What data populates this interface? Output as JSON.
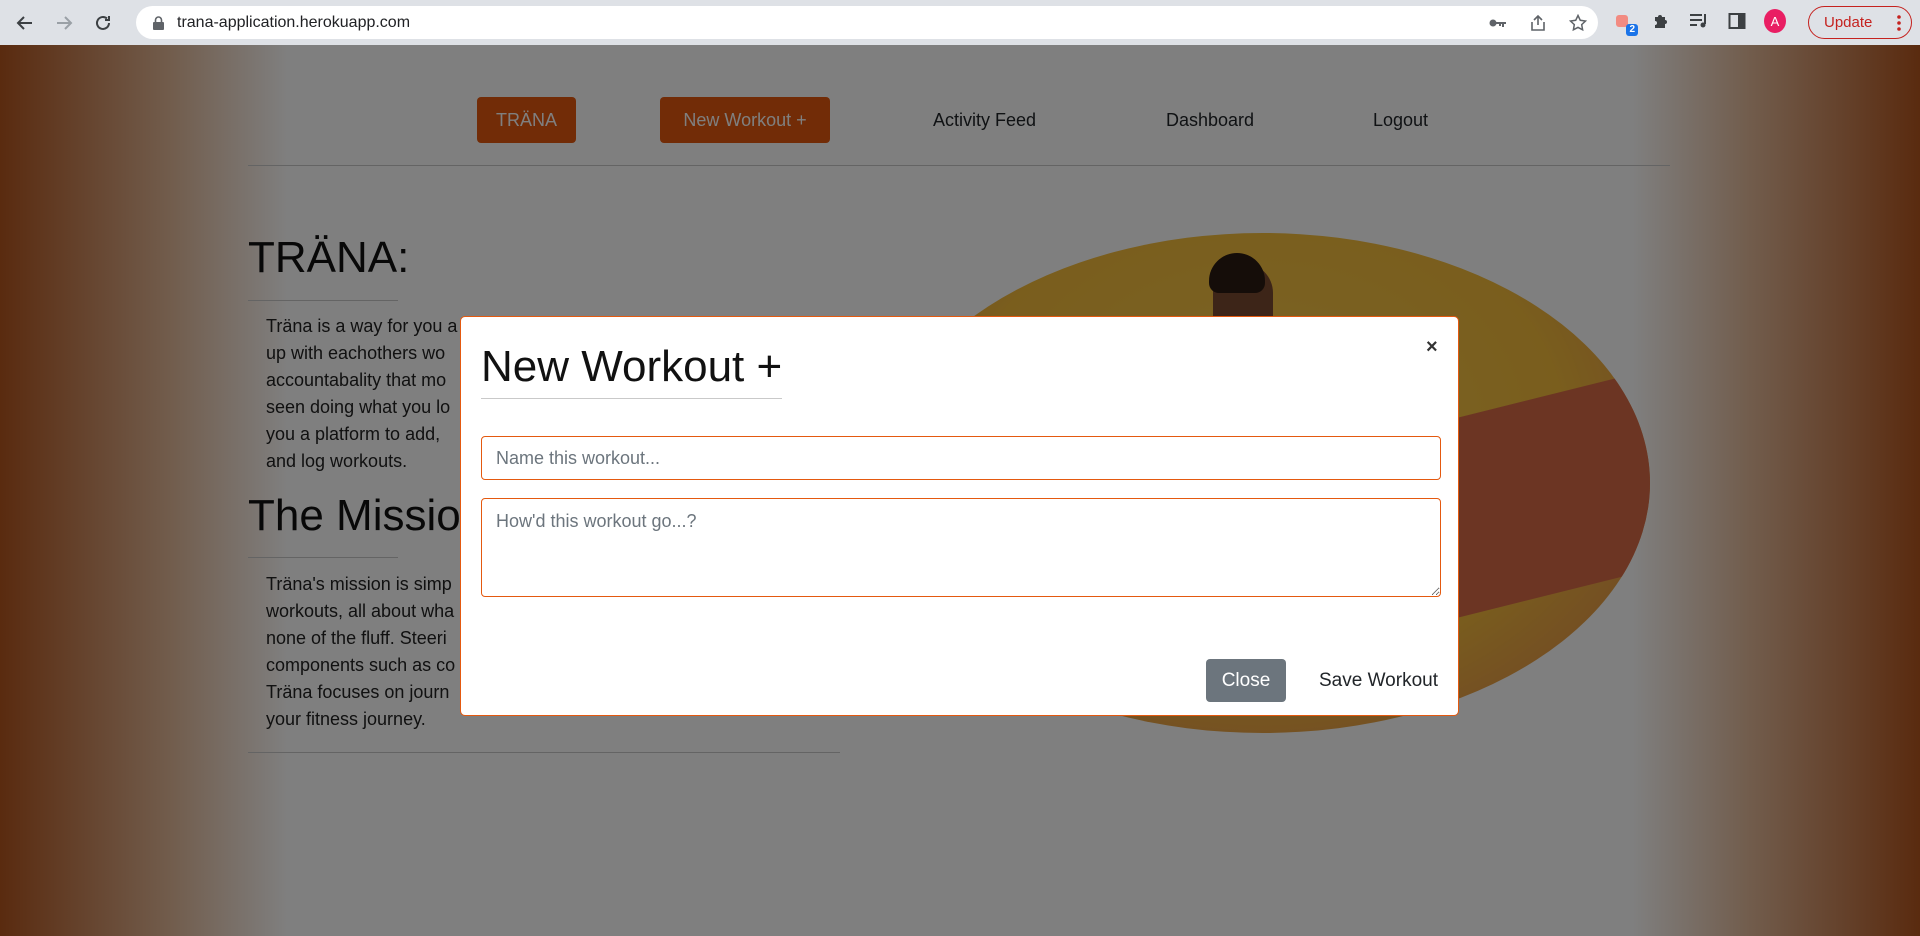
{
  "browser": {
    "url": "trana-application.herokuapp.com",
    "extension_badge": "2",
    "avatar_letter": "A",
    "update_label": "Update"
  },
  "nav": {
    "brand": "TRÄNA",
    "new_workout": "New Workout +",
    "activity_feed": "Activity Feed",
    "dashboard": "Dashboard",
    "logout": "Logout"
  },
  "about": {
    "title": "TRÄNA:",
    "lines": [
      "Träna is a way for you a",
      "up with eachothers wo",
      "accountabality that mo",
      "seen doing what you lo",
      "you a platform to add,",
      "and log workouts."
    ]
  },
  "mission": {
    "title": "The Mission",
    "lines": [
      "Träna's mission is simp",
      "workouts, all about wha",
      "none of the fluff. Steeri",
      "components such as co",
      "Träna focuses on journ",
      "your fitness journey."
    ]
  },
  "modal": {
    "title": "New Workout +",
    "close_symbol": "×",
    "name_placeholder": "Name this workout...",
    "notes_placeholder": "How'd this workout go...?",
    "close_button": "Close",
    "save_button": "Save Workout"
  },
  "colors": {
    "accent": "#e4590f",
    "secondary": "#6c757d"
  }
}
